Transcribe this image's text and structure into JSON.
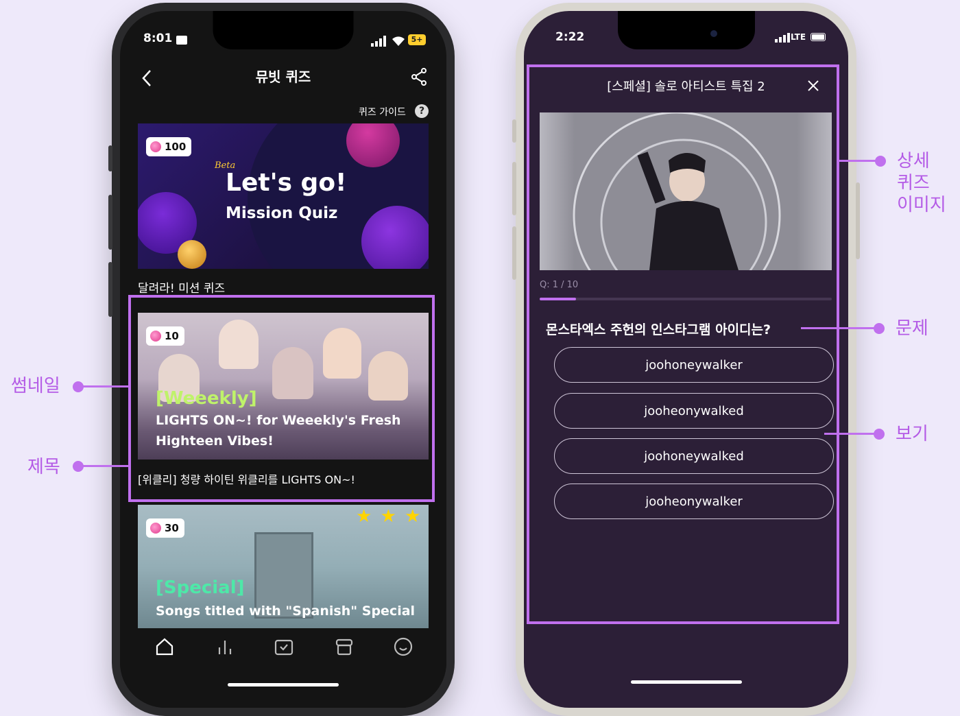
{
  "left_phone": {
    "status_time": "8:01",
    "battery_label": "5+",
    "header_title": "뮤빗 퀴즈",
    "quiz_guide": "퀴즈 가이드",
    "banner": {
      "points": "100",
      "beta": "Beta",
      "line1": "Let's go!",
      "line2": "Mission Quiz",
      "caption": "달려라! 미션 퀴즈"
    },
    "card1": {
      "points": "10",
      "tag": "[Weeekly]",
      "overlay_line1": "LIGHTS ON~! for Weeekly's Fresh",
      "overlay_line2": "Highteen Vibes!",
      "caption": "[위클리] 청량 하이틴 위클리를 LIGHTS ON~!"
    },
    "card2": {
      "points": "30",
      "stars": "★ ★ ★",
      "tag": "[Special]",
      "overlay_line1": "Songs titled with \"Spanish\" Special"
    },
    "nav_icons": [
      "home-icon",
      "chart-icon",
      "vote-icon",
      "store-icon",
      "profile-icon"
    ]
  },
  "right_phone": {
    "status_time": "2:22",
    "network": "LTE",
    "quiz_header": "[스페셜] 솔로 아티스트 특집 2",
    "progress_text": "Q: 1 / 10",
    "progress": 0.125,
    "question": "몬스타엑스 주헌의 인스타그램 아이디는?",
    "options": [
      "joohoneywalker",
      "jooheonywalked",
      "joohoneywalked",
      "jooheonywalker"
    ]
  },
  "annotations": {
    "thumbnail": "썸네일",
    "title": "제목",
    "detail_image": [
      "상세",
      "퀴즈",
      "이미지"
    ],
    "question": "문제",
    "options": "보기"
  },
  "colors": {
    "accent": "#c070ee",
    "label": "#b45be6",
    "background": "#eee9fa",
    "quiz_screen": "#2c1f37"
  }
}
